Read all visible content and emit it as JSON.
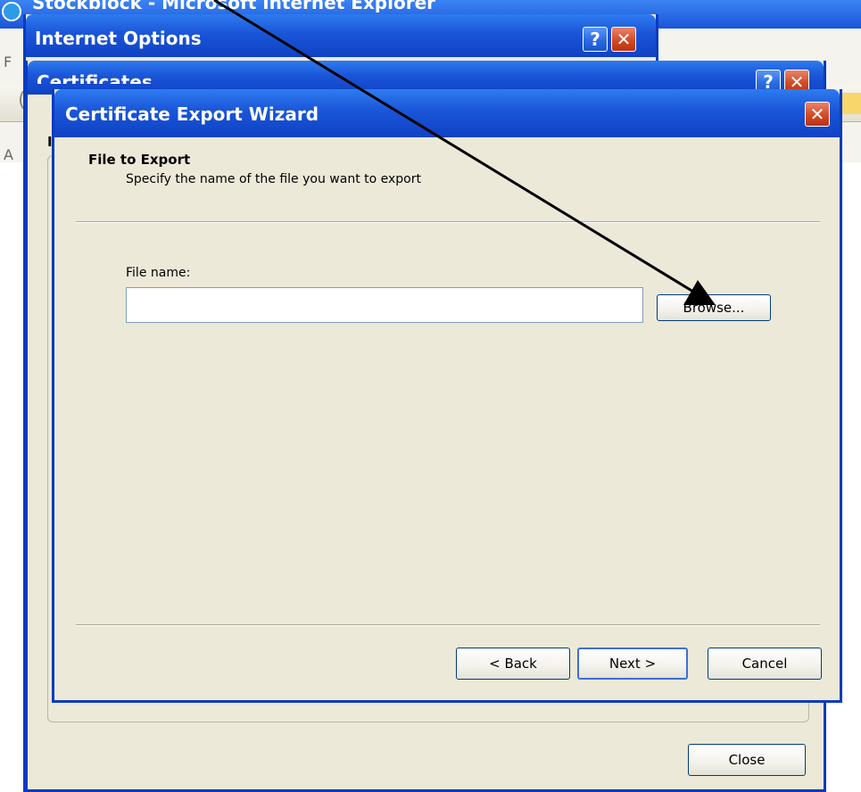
{
  "background": {
    "ie_title": "Stockblock - Microsoft Internet Explorer",
    "left_fragment_1": "F",
    "left_fragment_2": "(",
    "left_fragment_3": "A"
  },
  "internet_options": {
    "title": "Internet Options",
    "help_glyph": "?",
    "close_glyph": "✕"
  },
  "certificates": {
    "title": "Certificates",
    "help_glyph": "?",
    "close_glyph": "✕",
    "left_char": "I",
    "close_button": "Close"
  },
  "wizard": {
    "title": "Certificate Export Wizard",
    "close_glyph": "✕",
    "heading": "File to Export",
    "subheading": "Specify the name of the file you want to export",
    "file_label": "File name:",
    "file_value": "",
    "browse_button": "Browse...",
    "back_button": "< Back",
    "next_button": "Next >",
    "cancel_button": "Cancel"
  },
  "colors": {
    "titlebar_blue": "#0f42c4",
    "dialog_face": "#ece9d8",
    "close_red": "#d24a25"
  }
}
